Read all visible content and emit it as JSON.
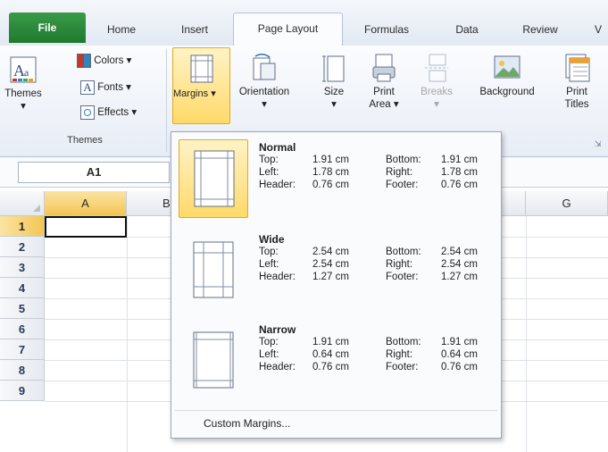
{
  "tabs": {
    "file": "File",
    "home": "Home",
    "insert": "Insert",
    "page_layout": "Page Layout",
    "formulas": "Formulas",
    "data": "Data",
    "review": "Review",
    "view_partial": "V"
  },
  "ribbon": {
    "themes": {
      "themes_label": "Themes",
      "colors_label": "Colors",
      "fonts_label": "Fonts",
      "effects_label": "Effects",
      "group_label": "Themes"
    },
    "page_setup": {
      "margins_label": "Margins",
      "orientation_label": "Orientation",
      "size_label": "Size",
      "print_area_label": "Print",
      "print_area_label2": "Area",
      "breaks_label": "Breaks",
      "background_label": "Background",
      "print_titles_label": "Print",
      "print_titles_label2": "Titles"
    }
  },
  "formula_bar": {
    "name_box": "A1"
  },
  "grid": {
    "columns": [
      "A",
      "B",
      "G"
    ],
    "rows": [
      "1",
      "2",
      "3",
      "4",
      "5",
      "6",
      "7",
      "8",
      "9"
    ]
  },
  "margins_menu": {
    "options": [
      {
        "title": "Normal",
        "top_label": "Top:",
        "top": "1.91 cm",
        "bottom_label": "Bottom:",
        "bottom": "1.91 cm",
        "left_label": "Left:",
        "left": "1.78 cm",
        "right_label": "Right:",
        "right": "1.78 cm",
        "header_label": "Header:",
        "header": "0.76 cm",
        "footer_label": "Footer:",
        "footer": "0.76 cm"
      },
      {
        "title": "Wide",
        "top_label": "Top:",
        "top": "2.54 cm",
        "bottom_label": "Bottom:",
        "bottom": "2.54 cm",
        "left_label": "Left:",
        "left": "2.54 cm",
        "right_label": "Right:",
        "right": "2.54 cm",
        "header_label": "Header:",
        "header": "1.27 cm",
        "footer_label": "Footer:",
        "footer": "1.27 cm"
      },
      {
        "title": "Narrow",
        "top_label": "Top:",
        "top": "1.91 cm",
        "bottom_label": "Bottom:",
        "bottom": "1.91 cm",
        "left_label": "Left:",
        "left": "0.64 cm",
        "right_label": "Right:",
        "right": "0.64 cm",
        "header_label": "Header:",
        "header": "0.76 cm",
        "footer_label": "Footer:",
        "footer": "0.76 cm"
      }
    ],
    "custom_label": "Custom Margins..."
  },
  "colors": {
    "file_tab": "#2a8a3b",
    "highlight": "#ffd96a",
    "selection_header": "#f3c653"
  }
}
